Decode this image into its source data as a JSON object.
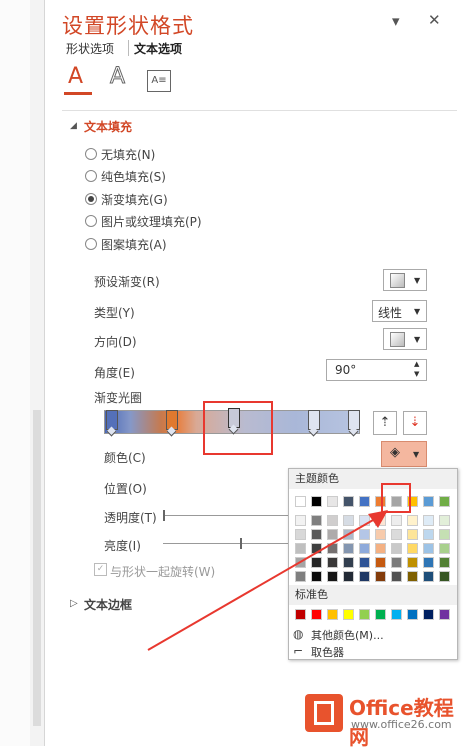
{
  "header": {
    "title": "设置形状格式",
    "pin": "▾",
    "close": "✕"
  },
  "tabs": [
    {
      "label": "形状选项"
    },
    {
      "label": "文本选项"
    }
  ],
  "icons": {
    "fill": "A",
    "outline": "A",
    "textbox": "A≡"
  },
  "text_fill": {
    "title": "文本填充",
    "options": [
      {
        "label": "无填充(N)",
        "selected": false
      },
      {
        "label": "纯色填充(S)",
        "selected": false
      },
      {
        "label": "渐变填充(G)",
        "selected": true
      },
      {
        "label": "图片或纹理填充(P)",
        "selected": false
      },
      {
        "label": "图案填充(A)",
        "selected": false
      }
    ]
  },
  "props": {
    "preset": "预设渐变(R)",
    "type": "类型(Y)",
    "type_value": "线性",
    "direction": "方向(D)",
    "angle": "角度(E)",
    "angle_value": "90°",
    "stops": "渐变光圈",
    "color": "颜色(C)",
    "position": "位置(O)",
    "transparency": "透明度(T)",
    "brightness": "亮度(I)",
    "rotate": "与形状一起旋转(W)"
  },
  "text_border": {
    "title": "文本边框"
  },
  "color_popup": {
    "theme_title": "主题颜色",
    "standard_title": "标准色",
    "more": "其他颜色(M)...",
    "eyedropper": "取色器",
    "theme_top": [
      "#ffffff",
      "#000000",
      "#e7e6e6",
      "#44546a",
      "#4472c4",
      "#ed7d31",
      "#a5a5a5",
      "#ffc000",
      "#5b9bd5",
      "#70ad47"
    ],
    "theme_shades": [
      [
        "#f2f2f2",
        "#7f7f7f",
        "#d0cece",
        "#d6dce4",
        "#d9e2f3",
        "#fbe5d5",
        "#ededed",
        "#fff2cc",
        "#deebf6",
        "#e2efd9"
      ],
      [
        "#d8d8d8",
        "#595959",
        "#aeabab",
        "#adb9ca",
        "#b4c6e7",
        "#f7cbac",
        "#dbdbdb",
        "#fee599",
        "#bdd7ee",
        "#c5e0b3"
      ],
      [
        "#bfbfbf",
        "#3f3f3f",
        "#757070",
        "#8496b0",
        "#8eaadb",
        "#f4b183",
        "#c9c9c9",
        "#ffd965",
        "#9dc3e6",
        "#a8d08d"
      ],
      [
        "#a5a5a5",
        "#262626",
        "#3a3838",
        "#323f4f",
        "#2f5496",
        "#c55a11",
        "#7b7b7b",
        "#bf9000",
        "#2e75b5",
        "#538135"
      ],
      [
        "#7f7f7f",
        "#0c0c0c",
        "#161616",
        "#222a35",
        "#1f3864",
        "#833c0b",
        "#525252",
        "#7f6000",
        "#1e4e79",
        "#375623"
      ]
    ],
    "standard": [
      "#c00000",
      "#ff0000",
      "#ffc000",
      "#ffff00",
      "#92d050",
      "#00b050",
      "#00b0f0",
      "#0070c0",
      "#002060",
      "#7030a0"
    ]
  },
  "watermark": {
    "brand": "Office教程网",
    "url": "www.office26.com"
  }
}
